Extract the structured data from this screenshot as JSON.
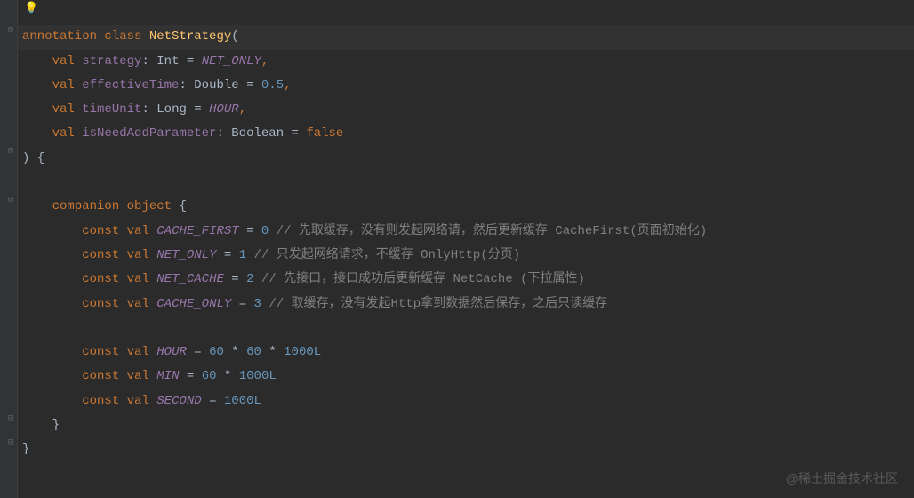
{
  "bulb": "💡",
  "line1": {
    "kw1": "annotation",
    "kw2": "class",
    "name": "NetStrategy",
    "paren": "("
  },
  "line2": {
    "kw": "val",
    "prop": "strategy",
    "colon": ":",
    "type": "Int",
    "eq": "=",
    "const": "NET_ONLY",
    "comma": ","
  },
  "line3": {
    "kw": "val",
    "prop": "effectiveTime",
    "colon": ":",
    "type": "Double",
    "eq": "=",
    "num": "0.5",
    "comma": ","
  },
  "line4": {
    "kw": "val",
    "prop": "timeUnit",
    "colon": ":",
    "type": "Long",
    "eq": "=",
    "const": "HOUR",
    "comma": ","
  },
  "line5": {
    "kw": "val",
    "prop": "isNeedAddParameter",
    "colon": ":",
    "type": "Boolean",
    "eq": "=",
    "val": "false"
  },
  "line6": {
    "paren": ")",
    "brace": "{"
  },
  "line8": {
    "kw1": "companion",
    "kw2": "object",
    "brace": "{"
  },
  "line9": {
    "kw1": "const",
    "kw2": "val",
    "name": "CACHE_FIRST",
    "eq": "=",
    "num": "0",
    "comment": "// 先取缓存，没有则发起网络请，然后更新缓存 CacheFirst(页面初始化)"
  },
  "line10": {
    "kw1": "const",
    "kw2": "val",
    "name": "NET_ONLY",
    "eq": "=",
    "num": "1",
    "comment": "// 只发起网络请求，不缓存 OnlyHttp(分页)"
  },
  "line11": {
    "kw1": "const",
    "kw2": "val",
    "name": "NET_CACHE",
    "eq": "=",
    "num": "2",
    "comment": "// 先接口，接口成功后更新缓存 NetCache (下拉属性)"
  },
  "line12": {
    "kw1": "const",
    "kw2": "val",
    "name": "CACHE_ONLY",
    "eq": "=",
    "num": "3",
    "comment": "// 取缓存，没有发起Http拿到数据然后保存，之后只读缓存"
  },
  "line14": {
    "kw1": "const",
    "kw2": "val",
    "name": "HOUR",
    "eq": "=",
    "expr_n1": "60",
    "op1": "*",
    "expr_n2": "60",
    "op2": "*",
    "expr_n3": "1000L"
  },
  "line15": {
    "kw1": "const",
    "kw2": "val",
    "name": "MIN",
    "eq": "=",
    "expr_n1": "60",
    "op1": "*",
    "expr_n2": "1000L"
  },
  "line16": {
    "kw1": "const",
    "kw2": "val",
    "name": "SECOND",
    "eq": "=",
    "expr_n1": "1000L"
  },
  "line17": {
    "brace": "}"
  },
  "line18": {
    "brace": "}"
  },
  "watermark": "@稀土掘金技术社区",
  "fold_markers": {
    "m1": "⊟",
    "m2": "⊟"
  }
}
